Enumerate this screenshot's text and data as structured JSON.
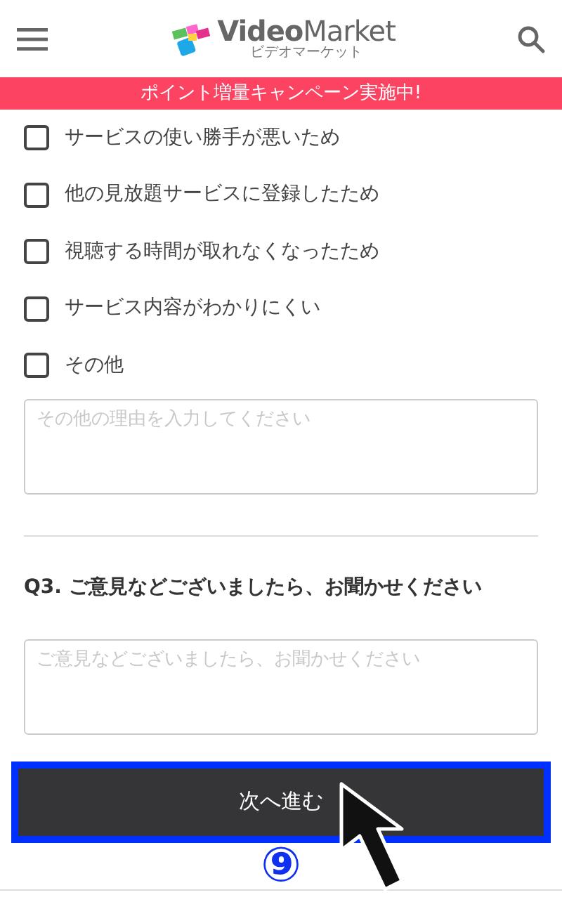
{
  "header": {
    "logo_text": "**Video**Market",
    "logo_subtext": "ビデオマーケット"
  },
  "banner": "ポイント増量キャンペーン実施中!",
  "reasons": [
    {
      "label": "サービスの使い勝手が悪いため",
      "checked": false
    },
    {
      "label": "他の見放題サービスに登録したため",
      "checked": false
    },
    {
      "label": "視聴する時間が取れなくなったため",
      "checked": false
    },
    {
      "label": "サービス内容がわかりにくい",
      "checked": false
    },
    {
      "label": "その他",
      "checked": false
    }
  ],
  "other_reason": {
    "placeholder": "その他の理由を入力してください"
  },
  "q3": {
    "title": "Q3. ご意見などございましたら、お聞かせください",
    "placeholder": "ご意見などございましたら、お聞かせください"
  },
  "next_button": {
    "label": "次へ進む",
    "highlighted": true
  },
  "step_marker": "⑨"
}
